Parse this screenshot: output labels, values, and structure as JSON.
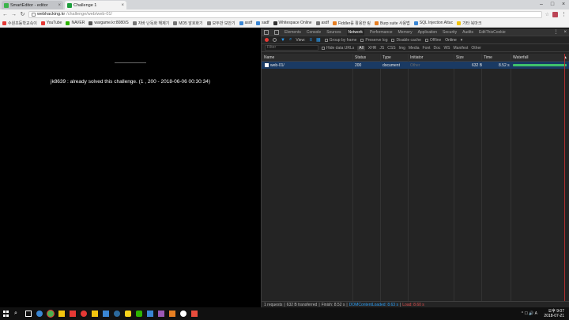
{
  "browser": {
    "tabs": [
      {
        "title": "SmartEditor - editor",
        "active": false
      },
      {
        "title": "Challenge 1",
        "active": true
      }
    ],
    "url_host": "webhacking.kr",
    "url_path": "/challenge/web/web-01/",
    "bookmarks": [
      {
        "label": "수원초등학교속이",
        "color": "#e53935"
      },
      {
        "label": "YouTube",
        "color": "#e53935"
      },
      {
        "label": "NAVER",
        "color": "#2db400"
      },
      {
        "label": "wargame.kr:8080/S",
        "color": "#555555"
      },
      {
        "label": "자바 난독화 해제기",
        "color": "#777777"
      },
      {
        "label": "MD5 암호화기",
        "color": "#777777"
      },
      {
        "label": "모두만 보안기",
        "color": "#777777"
      },
      {
        "label": "asdf",
        "color": "#3a86d4"
      },
      {
        "label": "sadf",
        "color": "#3a86d4"
      },
      {
        "label": "Whitespace Online",
        "color": "#333333"
      },
      {
        "label": "asdf",
        "color": "#777777"
      },
      {
        "label": "Fiddler를 활용한 링",
        "color": "#e67e22"
      },
      {
        "label": "Burp suite 사용법",
        "color": "#e67e22"
      },
      {
        "label": "SQL Injection Attac",
        "color": "#3a86d4"
      },
      {
        "label": "기타 북마크",
        "color": "#f1c40f"
      }
    ]
  },
  "page": {
    "dashes": "--------------------",
    "message": "jk8639 : already solved this challenge. (1 , 200 - 2018-06-06 00:30:34)"
  },
  "devtools": {
    "tabs": [
      "Elements",
      "Console",
      "Sources",
      "Network",
      "Performance",
      "Memory",
      "Application",
      "Security",
      "Audits",
      "EditThisCookie"
    ],
    "active_tab": "Network",
    "controls": {
      "view_label": "View:",
      "group_by_frame": "Group by frame",
      "preserve_log": "Preserve log",
      "disable_cache": "Disable cache",
      "offline": "Offline",
      "throttle": "Online"
    },
    "filter": {
      "placeholder": "Filter",
      "hide_data_urls": "Hide data URLs",
      "types": [
        "All",
        "XHR",
        "JS",
        "CSS",
        "Img",
        "Media",
        "Font",
        "Doc",
        "WS",
        "Manifest",
        "Other"
      ]
    },
    "columns": {
      "name": "Name",
      "status": "Status",
      "type": "Type",
      "initiator": "Initiator",
      "size": "Size",
      "time": "Time",
      "waterfall": "Waterfall",
      "sort": "▲"
    },
    "rows": [
      {
        "name": "web-01/",
        "status": "200",
        "type": "document",
        "initiator": "Other",
        "size": "632 B",
        "time": "8.52 s"
      }
    ],
    "status_bar": {
      "requests": "1 requests",
      "transferred": "632 B transferred",
      "finish": "Finish: 8.52 s",
      "dom": "DOMContentLoaded: 8.63 s",
      "load": "Load: 8.60 s"
    }
  },
  "taskbar": {
    "apps": [
      {
        "name": "search",
        "color": "#ffffff"
      },
      {
        "name": "task-view",
        "color": "#ffffff"
      },
      {
        "name": "edge",
        "color": "#3a86d4"
      },
      {
        "name": "chrome",
        "color": "#4caf50"
      },
      {
        "name": "explorer",
        "color": "#f1c40f"
      },
      {
        "name": "mcafee",
        "color": "#e53935"
      },
      {
        "name": "app",
        "color": "#e53935"
      },
      {
        "name": "folder",
        "color": "#f1c40f"
      },
      {
        "name": "store",
        "color": "#3a86d4"
      },
      {
        "name": "steam",
        "color": "#2c6a9e"
      },
      {
        "name": "kakaotalk",
        "color": "#f7d21b"
      },
      {
        "name": "line",
        "color": "#2db400"
      },
      {
        "name": "app2",
        "color": "#3a86d4"
      },
      {
        "name": "app3",
        "color": "#9b59b6"
      },
      {
        "name": "app4",
        "color": "#e67e22"
      },
      {
        "name": "app5",
        "color": "#ffffff"
      },
      {
        "name": "app6",
        "color": "#e74c3c"
      }
    ],
    "tray": "^ ☐ 🔊 A",
    "time": "오후 9:07",
    "date": "2018-07-21"
  },
  "colors": {
    "accent": "#2a9df4",
    "selected_row": "#1a3a63",
    "waterfall_bar": "#3fc26b"
  }
}
